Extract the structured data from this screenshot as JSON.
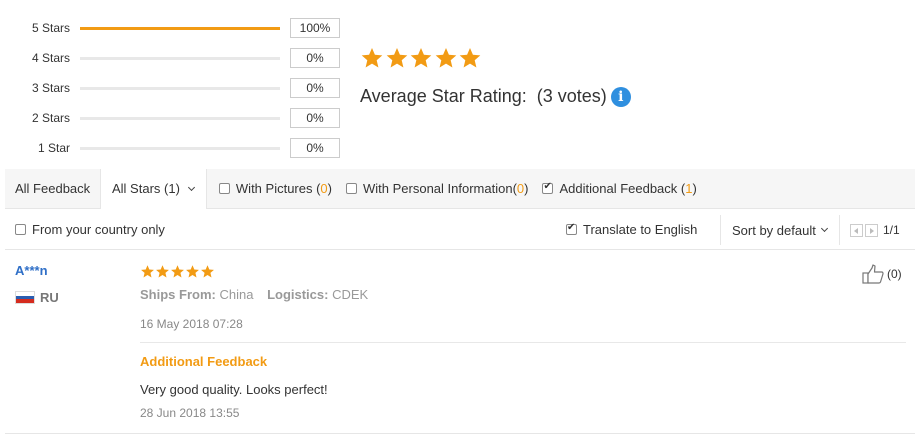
{
  "rating_breakdown": [
    {
      "label": "5 Stars",
      "percent_text": "100%",
      "fill": 1.0
    },
    {
      "label": "4 Stars",
      "percent_text": "0%",
      "fill": 0
    },
    {
      "label": "3 Stars",
      "percent_text": "0%",
      "fill": 0
    },
    {
      "label": "2 Stars",
      "percent_text": "0%",
      "fill": 0
    },
    {
      "label": "1 Star",
      "percent_text": "0%",
      "fill": 0
    }
  ],
  "average": {
    "stars": 5,
    "label": "Average Star Rating:",
    "votes": "(3 votes)",
    "info_icon": "info-icon"
  },
  "filters": {
    "all_feedback": "All Feedback",
    "stars_select": "All Stars (1)",
    "with_pictures": "With Pictures (",
    "with_pictures_count": "0",
    "with_personal": "With Personal Information(",
    "with_personal_count": "0",
    "additional": "Additional Feedback (",
    "additional_count": "1",
    "close_paren": ")"
  },
  "options": {
    "country_only": "From your country only",
    "translate": "Translate to English",
    "sort": "Sort by default",
    "page": "1/1"
  },
  "review": {
    "user": "A***n",
    "country": "RU",
    "stars": 5,
    "ships_from_label": "Ships From:",
    "ships_from": "China",
    "logistics_label": "Logistics:",
    "logistics": "CDEK",
    "date": "16 May 2018 07:28",
    "additional_title": "Additional Feedback",
    "additional_text": "Very good quality. Looks perfect!",
    "additional_date": "28 Jun 2018 13:55",
    "helpful_count": "(0)"
  },
  "colors": {
    "accent": "#f29b14",
    "link": "#2f6fc7",
    "info": "#2f8fdf"
  }
}
